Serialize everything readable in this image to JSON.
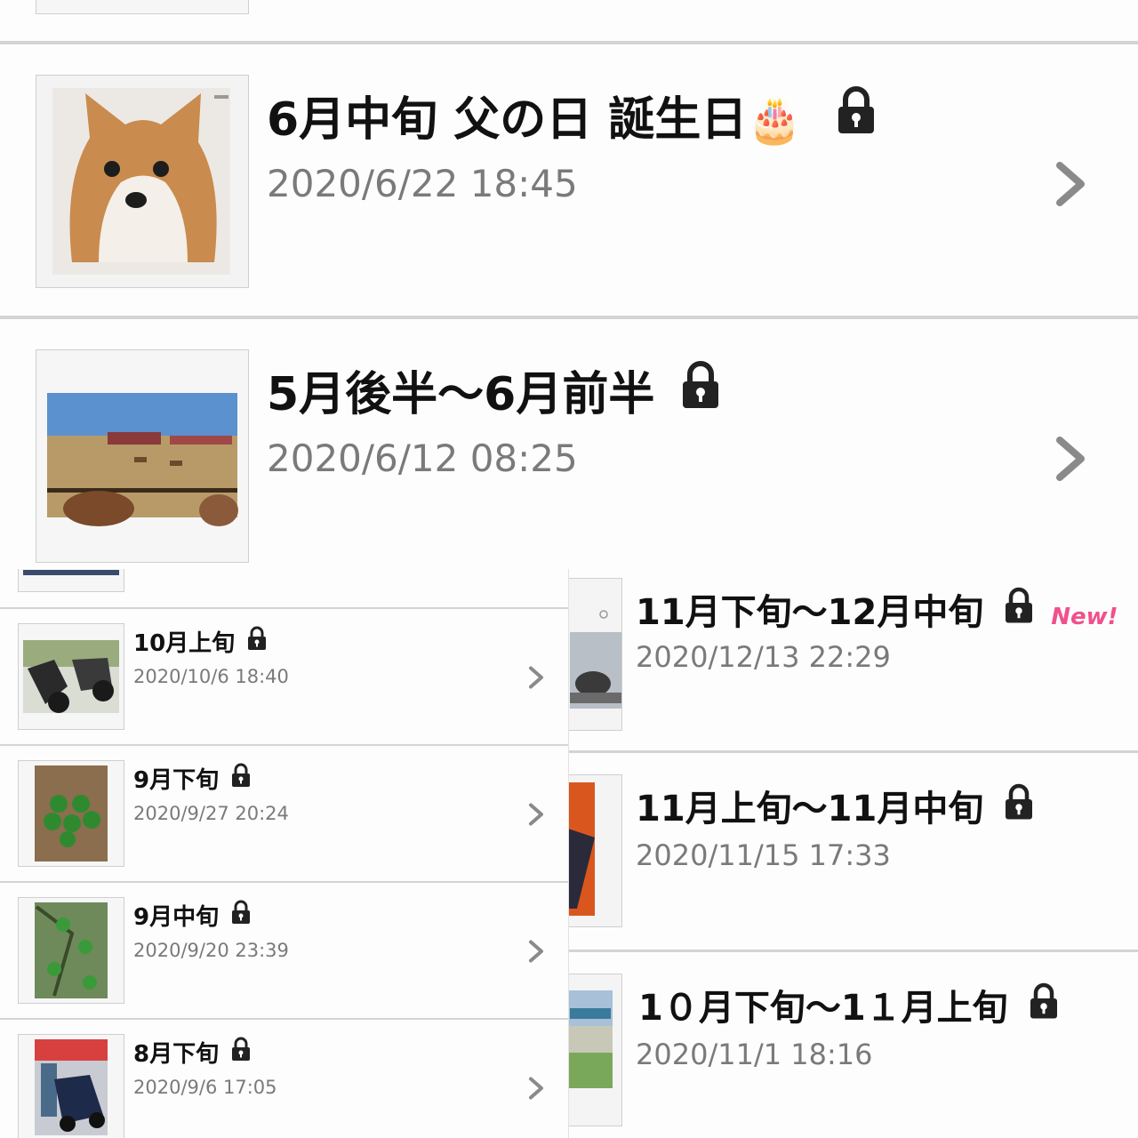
{
  "top_panel": {
    "entries": [
      {
        "title": "6月中旬 父の日 誕生日",
        "title_emoji": "🎂",
        "locked": true,
        "date": "2020/6/22 18:45",
        "thumb_icon": "shiba-dog-photo"
      },
      {
        "title": "5月後半〜6月前半",
        "locked": true,
        "date": "2020/6/12 08:25",
        "thumb_icon": "farm-field-photo"
      }
    ]
  },
  "left_panel": {
    "entries": [
      {
        "title": "10月上旬",
        "locked": true,
        "date": "2020/10/6 18:40",
        "thumb_icon": "motorcycles-photo"
      },
      {
        "title": "9月下旬",
        "locked": true,
        "date": "2020/9/27 20:24",
        "thumb_icon": "green-fruits-photo"
      },
      {
        "title": "9月中旬",
        "locked": true,
        "date": "2020/9/20 23:39",
        "thumb_icon": "fruit-tree-photo"
      },
      {
        "title": "8月下旬",
        "locked": true,
        "date": "2020/9/6 17:05",
        "thumb_icon": "motorcycle-photo"
      }
    ]
  },
  "right_panel": {
    "entries": [
      {
        "title": "11月下旬〜12月中旬",
        "locked": true,
        "badge": "New!",
        "date": "2020/12/13 22:29",
        "thumb_icon": "motorcycle-screenshot"
      },
      {
        "title": "11月上旬〜11月中旬",
        "locked": true,
        "date": "2020/11/15 17:33",
        "thumb_icon": "orange-scene-photo"
      },
      {
        "title": "1０月下旬〜1１月上旬",
        "locked": true,
        "date": "2020/11/1 18:16",
        "thumb_icon": "river-sign-photo"
      }
    ]
  },
  "colors": {
    "divider": "#d4d4d4",
    "date": "#7a7a7a",
    "badge": "#f0508c",
    "chevron": "#8a8a8a"
  }
}
